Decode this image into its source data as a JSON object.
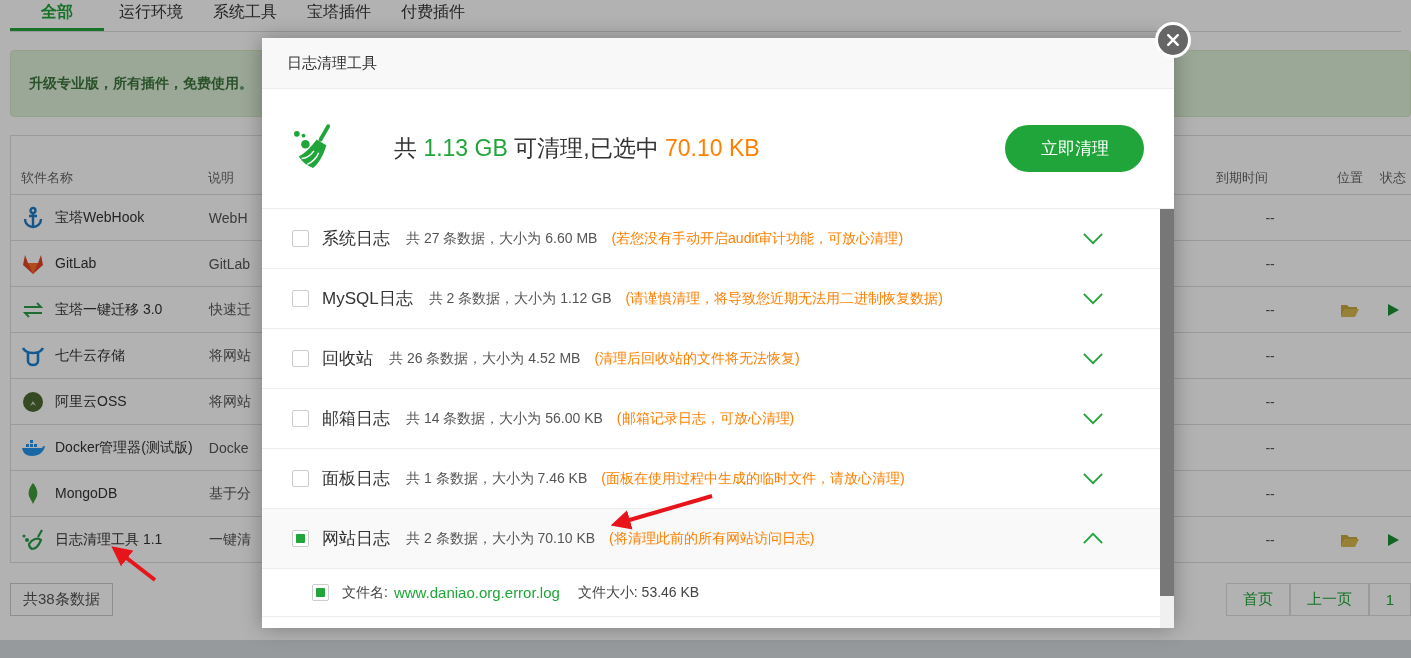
{
  "tabs": [
    {
      "label": "全部",
      "selected": true
    },
    {
      "label": "运行环境",
      "selected": false
    },
    {
      "label": "系统工具",
      "selected": false
    },
    {
      "label": "宝塔插件",
      "selected": false
    },
    {
      "label": "付费插件",
      "selected": false
    }
  ],
  "notice": "升级专业版，所有插件，免费使用。",
  "table": {
    "columns": [
      {
        "kind": "name",
        "label": "软件名称"
      },
      {
        "kind": "desc",
        "label": "说明"
      },
      {
        "kind": "expire",
        "label": "到期时间"
      },
      {
        "kind": "location",
        "label": "位置"
      },
      {
        "kind": "status",
        "label": "状态"
      }
    ],
    "rows": [
      {
        "name": "宝塔WebHook",
        "description": "WebH",
        "expire": "--",
        "actions": false
      },
      {
        "name": "GitLab",
        "description": "GitLab",
        "expire": "--",
        "actions": false
      },
      {
        "name": "宝塔一键迁移 3.0",
        "description": "快速迁",
        "expire": "--",
        "actions": true
      },
      {
        "name": "七牛云存储",
        "description": "将网站",
        "expire": "--",
        "actions": false
      },
      {
        "name": "阿里云OSS",
        "description": "将网站",
        "expire": "--",
        "actions": false
      },
      {
        "name": "Docker管理器(测试版)",
        "description": "Docke",
        "expire": "--",
        "actions": false
      },
      {
        "name": "MongoDB",
        "description": "基于分",
        "expire": "--",
        "actions": false
      },
      {
        "name": "日志清理工具 1.1",
        "description": "一键清",
        "expire": "--",
        "actions": true
      }
    ]
  },
  "total": "共38条数据",
  "pagination": [
    {
      "label": "首页"
    },
    {
      "label": "上一页"
    },
    {
      "label": "1"
    }
  ],
  "dialog": {
    "title": "日志清理工具",
    "summary": {
      "prefix": "共",
      "total": "1.13 GB",
      "middle": "可清理,已选中",
      "selected": "70.10 KB"
    },
    "button": "立即清理",
    "categories": [
      {
        "name": "系统日志",
        "info": "共 27 条数据，大小为 6.60 MB",
        "note": "(若您没有手动开启audit审计功能，可放心清理)",
        "checked": false,
        "expanded": false
      },
      {
        "name": "MySQL日志",
        "info": "共 2 条数据，大小为 1.12 GB",
        "note": "(请谨慎清理，将导致您近期无法用二进制恢复数据)",
        "checked": false,
        "expanded": false
      },
      {
        "name": "回收站",
        "info": "共 26 条数据，大小为 4.52 MB",
        "note": "(清理后回收站的文件将无法恢复)",
        "checked": false,
        "expanded": false
      },
      {
        "name": "邮箱日志",
        "info": "共 14 条数据，大小为 56.00 KB",
        "note": "(邮箱记录日志，可放心清理)",
        "checked": false,
        "expanded": false
      },
      {
        "name": "面板日志",
        "info": "共 1 条数据，大小为 7.46 KB",
        "note": "(面板在使用过程中生成的临时文件，请放心清理)",
        "checked": false,
        "expanded": false
      },
      {
        "name": "网站日志",
        "info": "共 2 条数据，大小为 70.10 KB",
        "note": "(将清理此前的所有网站访问日志)",
        "checked": true,
        "expanded": true,
        "files": [
          {
            "label": "文件名:",
            "filename": "www.daniao.org.error.log",
            "size": "文件大小: 53.46 KB",
            "checked": true
          }
        ]
      }
    ]
  }
}
